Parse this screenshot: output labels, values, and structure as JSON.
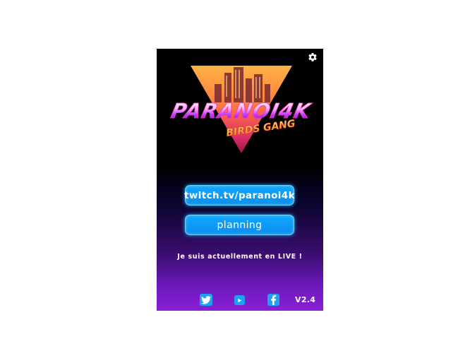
{
  "logo": {
    "title": "PARANOI4K",
    "subtitle": "BIRDS GANG"
  },
  "buttons": {
    "twitch_label": "twitch.tv/paranoi4k",
    "planning_label": "planning"
  },
  "status": {
    "live_text": "Je suis actuellement en LIVE !"
  },
  "footer": {
    "version": "V2.4",
    "icons": [
      "twitter-icon",
      "youtube-icon",
      "facebook-icon"
    ]
  },
  "colors": {
    "button": "#0a8fee",
    "accent_pink": "#ff2fae",
    "accent_orange": "#ff9a3c",
    "social": "#1da1f2"
  }
}
